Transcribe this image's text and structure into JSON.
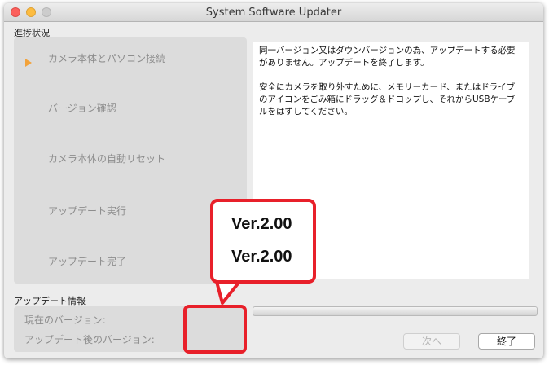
{
  "window": {
    "title": "System Software Updater"
  },
  "progress": {
    "label": "進捗状況",
    "steps": [
      {
        "label": "カメラ本体とパソコン接続",
        "active": true
      },
      {
        "label": "バージョン確認",
        "active": false
      },
      {
        "label": "カメラ本体の自動リセット",
        "active": false
      },
      {
        "label": "アップデート実行",
        "active": false
      },
      {
        "label": "アップデート完了",
        "active": false
      }
    ]
  },
  "message": {
    "paragraph1": "同一バージョン又はダウンバージョンの為、アップデートする必要がありません。アップデートを終了します。",
    "paragraph2": "安全にカメラを取り外すために、メモリーカード、またはドライブのアイコンをごみ箱にドラッグ＆ドロップし、それからUSBケーブルをはずしてください。"
  },
  "update_info": {
    "label": "アップデート情報",
    "current_version_label": "現在のバージョン:",
    "after_version_label": "アップデート後のバージョン:"
  },
  "callout": {
    "current_version": "Ver.2.00",
    "after_version": "Ver.2.00"
  },
  "buttons": {
    "next": "次へ",
    "quit": "終了"
  },
  "colors": {
    "highlight": "#e8202a",
    "active_step_arrow": "#f2a23a"
  }
}
